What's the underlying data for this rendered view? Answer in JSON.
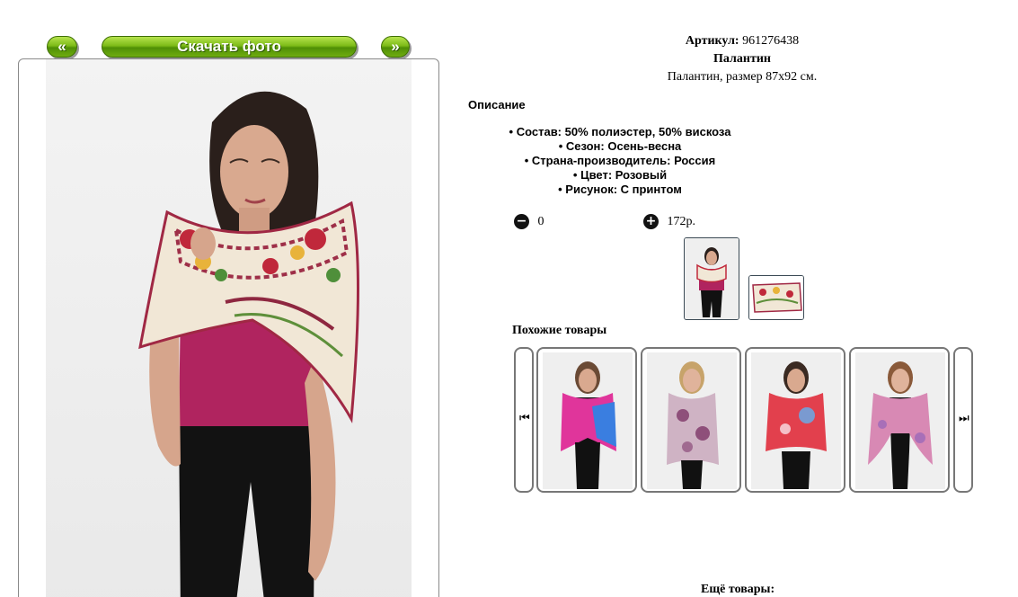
{
  "nav": {
    "prev_label": "«",
    "download_label": "Скачать фото",
    "next_label": "»"
  },
  "product": {
    "article_label": "Артикул:",
    "article_value": "961276438",
    "name": "Палантин",
    "subtitle": "Палантин, размер 87х92 см.",
    "description_heading": "Описание",
    "properties": [
      "Состав: 50% полиэстер, 50% вискоза",
      "Сезон: Осень-весна",
      "Страна-производитель: Россия",
      "Цвет: Розовый",
      "Рисунок: С принтом"
    ],
    "quantity": "0",
    "price": "172р."
  },
  "similar": {
    "title": "Похожие товары",
    "prev_icon": "skip-back-icon",
    "next_icon": "skip-forward-icon",
    "items": [
      {
        "scarf_color": "#e0359b",
        "accent": "#3a7ee0"
      },
      {
        "scarf_color": "#cfb3c4",
        "accent": "#8e4f7a"
      },
      {
        "scarf_color": "#e2404d",
        "accent": "#7a9ad0"
      },
      {
        "scarf_color": "#d889b4",
        "accent": "#a86fb8"
      }
    ]
  },
  "more_title": "Ещё товары:",
  "colors": {
    "button_green": "#6fac10",
    "border_gray": "#777777",
    "shirt": "#b0245f",
    "scarf_base": "#f1e7d6",
    "scarf_red": "#c0283b"
  }
}
